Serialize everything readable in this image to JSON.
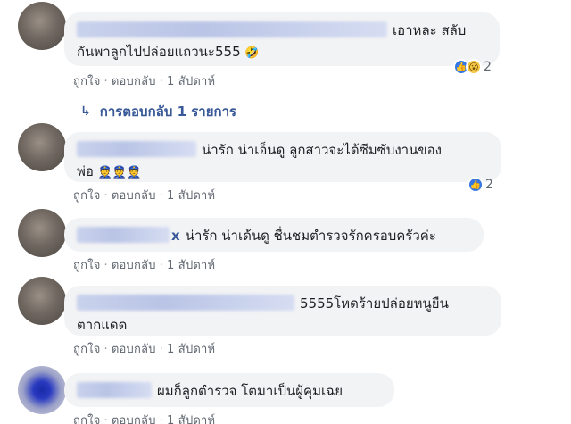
{
  "comments": [
    {
      "text_line1": "เอาหละ สลับ",
      "text_line2": "กันพาลูกไปปล่อยแถวนะ555",
      "emoji": "🤣",
      "like_label": "ถูกใจ",
      "reply_label": "ตอบกลับ",
      "time": "1 สัปดาห์",
      "reaction_count": "2",
      "replies_label": "การตอบกลับ 1 รายการ"
    },
    {
      "text_line1": "น่ารัก น่าเอ็นดู ลูกสาวจะได้ซึมซับงานของ",
      "text_line2": "พ่อ",
      "emoji": "👮👮👮",
      "like_label": "ถูกใจ",
      "reply_label": "ตอบกลับ",
      "time": "1 สัปดาห์",
      "reaction_count": "2"
    },
    {
      "name_tail": "x",
      "text_line1": "น่ารัก น่าเด้นดู ชื่นชมตำรวจรักครอบครัวค่ะ",
      "like_label": "ถูกใจ",
      "reply_label": "ตอบกลับ",
      "time": "1 สัปดาห์"
    },
    {
      "text_line1": "5555โหดร้ายปล่อยหนูยืน",
      "text_line2": "ตากแดด",
      "like_label": "ถูกใจ",
      "reply_label": "ตอบกลับ",
      "time": "1 สัปดาห์"
    },
    {
      "text_line1": "ผมก็ลูกตำรวจ โตมาเป็นผู้คุมเฉย",
      "like_label": "ถูกใจ",
      "reply_label": "ตอบกลับ",
      "time": "1 สัปดาห์"
    }
  ],
  "separator": "·",
  "icons": {
    "like": "like-icon",
    "wow": "wow-icon",
    "reply_arrow": "reply-arrow-icon"
  },
  "colors": {
    "link": "#385898",
    "bubble": "#f2f3f5",
    "meta": "#606770"
  }
}
